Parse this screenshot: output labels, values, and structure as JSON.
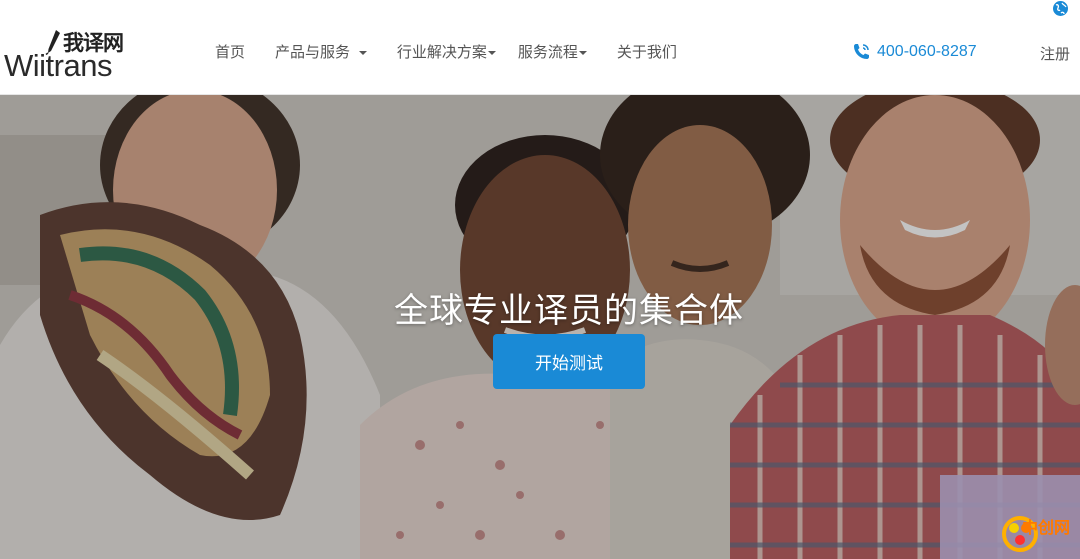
{
  "logo": {
    "cn": "我译网",
    "en": "Wiitrans"
  },
  "nav": {
    "items": [
      {
        "label": "首页"
      },
      {
        "label": "产品与服务"
      },
      {
        "label": "行业解决方案"
      },
      {
        "label": "服务流程"
      },
      {
        "label": "关于我们"
      }
    ],
    "phone": "400-060-8287",
    "register": "注册"
  },
  "hero": {
    "title": "全球专业译员的集合体",
    "button": "开始测试"
  },
  "watermark": {
    "text": "中创网"
  },
  "colors": {
    "accent": "#1a8ad6",
    "nav_text": "#555555"
  },
  "icons": {
    "phone": "phone-icon",
    "globe": "globe-icon",
    "dropdown": "caret-down-icon"
  }
}
